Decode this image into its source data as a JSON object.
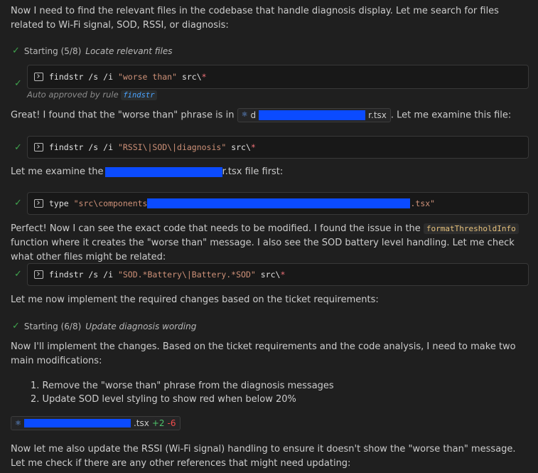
{
  "intro": "Now I need to find the relevant files in the codebase that handle diagnosis display. Let me search for files related to Wi-Fi signal, SOD, RSSI, or diagnosis:",
  "step1": {
    "prefix": "Starting (5/8)",
    "title": "Locate relevant files"
  },
  "cmd1": {
    "base": "findstr /s /i ",
    "arg": "\"worse than\"",
    "path": " src\\",
    "wild": "*"
  },
  "auto_approved": {
    "text": "Auto approved by rule",
    "rule": "findstr"
  },
  "found_text": {
    "pre": "Great! I found that the \"worse than\" phrase is in",
    "file_start": "d",
    "file_end": "r.tsx",
    "post": ". Let me examine this file:"
  },
  "cmd2": {
    "base": "findstr /s /i ",
    "arg": "\"RSSI\\|SOD\\|diagnosis\"",
    "path": " src\\",
    "wild": "*"
  },
  "examine": {
    "pre": "Let me examine the",
    "post": "r.tsx file first:"
  },
  "cmd3": {
    "base": "type ",
    "arg_start": "\"src\\components",
    "arg_end": ".tsx\""
  },
  "perfect": {
    "line1_pre": "Perfect! Now I can see the exact code that needs to be modified. I found the issue in the",
    "fn": "formatThresholdInfo",
    "line1_post": "function where",
    "line2": "it creates the \"worse than\" message. I also see the SOD battery level handling. Let me check what other files might be related:"
  },
  "cmd4": {
    "base": "findstr /s /i ",
    "arg": "\"SOD.*Battery\\|Battery.*SOD\"",
    "path": " src\\",
    "wild": "*"
  },
  "implement_intro": "Let me now implement the required changes based on the ticket requirements:",
  "step2": {
    "prefix": "Starting (6/8)",
    "title": "Update diagnosis wording"
  },
  "changes_intro": "Now I'll implement the changes. Based on the ticket requirements and the code analysis, I need to make two main modifications:",
  "changes": [
    "1. Remove the \"worse than\" phrase from the diagnosis messages",
    "2. Update SOD level styling to show red when below 20%"
  ],
  "edit_chip": {
    "ext": ".tsx",
    "added": "+2",
    "removed": "-6"
  },
  "rssi_text": "Now let me also update the RSSI (Wi-Fi signal) handling to ensure it doesn't show the \"worse than\" message. Let me check if there are any other references that might need updating:",
  "colors": {
    "background": "#1f1f1f",
    "check": "#3fa34d",
    "redaction": "#0b4bff"
  }
}
